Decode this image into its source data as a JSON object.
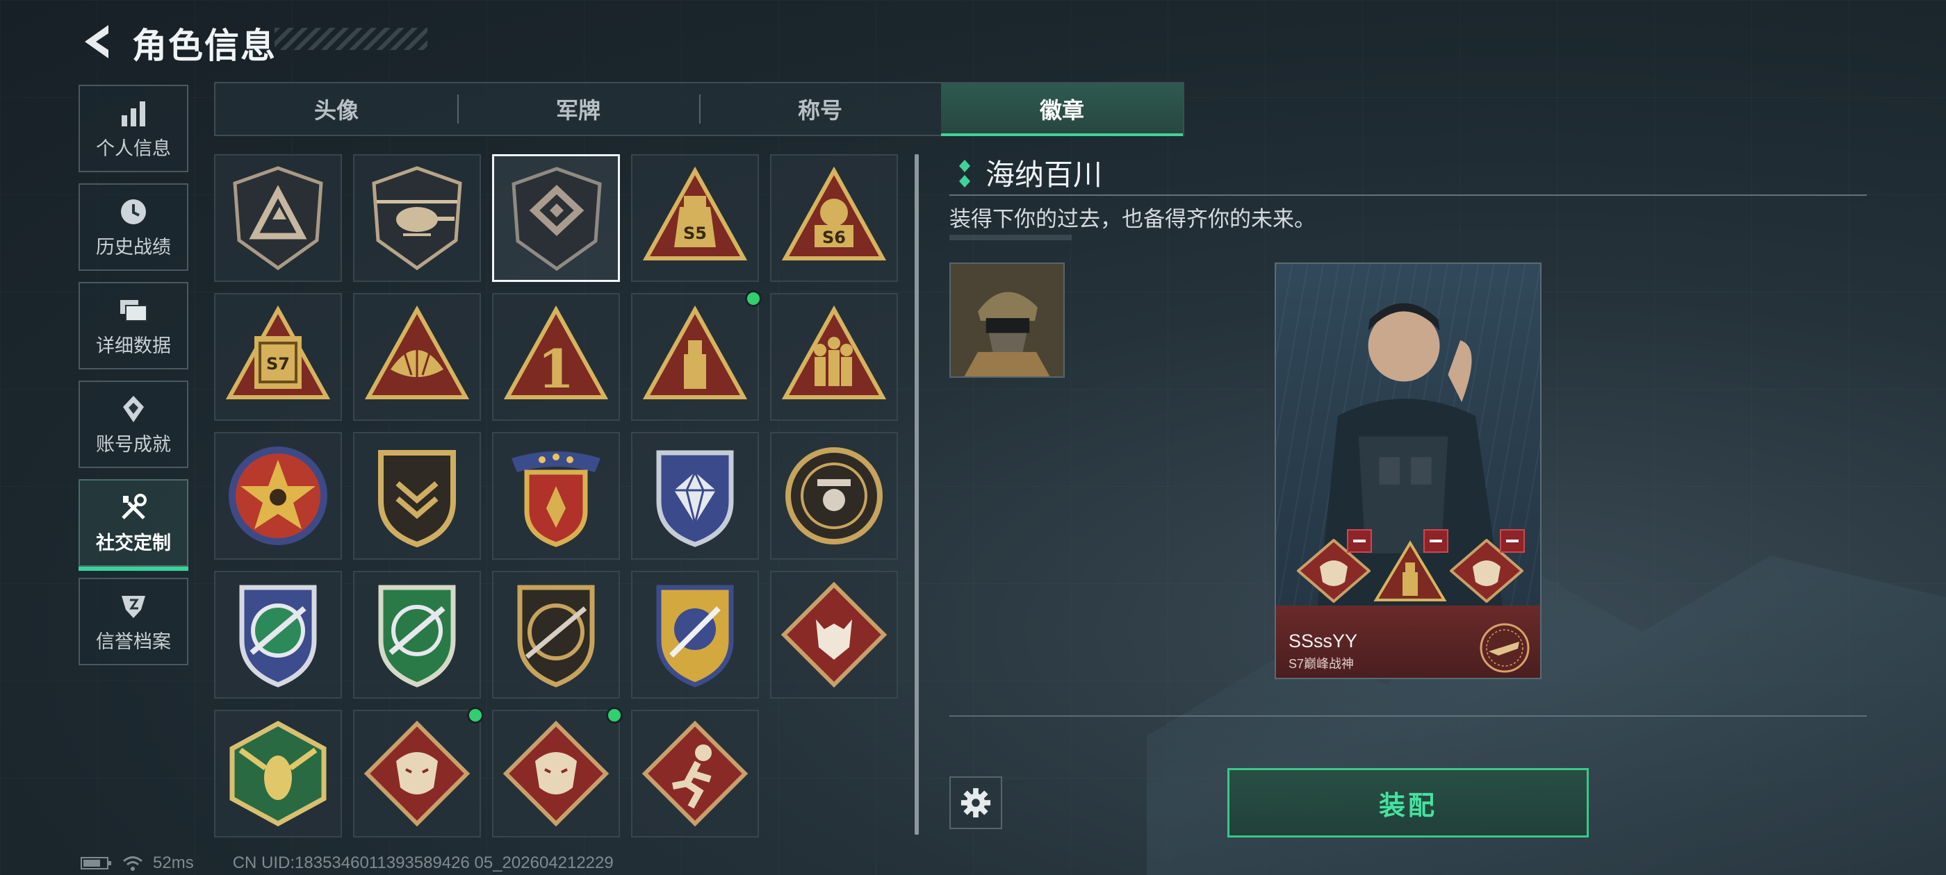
{
  "header": {
    "title": "角色信息"
  },
  "sidebar": {
    "items": [
      {
        "label": "个人信息",
        "icon": "bar-chart-icon"
      },
      {
        "label": "历史战绩",
        "icon": "clock-icon"
      },
      {
        "label": "详细数据",
        "icon": "folder-icon"
      },
      {
        "label": "账号成就",
        "icon": "achievement-icon"
      },
      {
        "label": "社交定制",
        "icon": "wrench-tools-icon",
        "active": true
      },
      {
        "label": "信誉档案",
        "icon": "shield-crest-icon"
      }
    ]
  },
  "tabs": [
    {
      "label": "头像"
    },
    {
      "label": "军牌"
    },
    {
      "label": "称号"
    },
    {
      "label": "徽章",
      "active": true
    }
  ],
  "badges": [
    {
      "name": "badge-triangle-a",
      "icon": "triangle-a-badge-icon"
    },
    {
      "name": "badge-helicopter",
      "icon": "helicopter-badge-icon"
    },
    {
      "name": "badge-diamond-emblem",
      "icon": "diamond-emblem-badge-icon",
      "selected": true
    },
    {
      "name": "badge-s5",
      "icon": "s5-badge-icon",
      "text": "S5"
    },
    {
      "name": "badge-s6",
      "icon": "s6-badge-icon",
      "text": "S6"
    },
    {
      "name": "badge-s7",
      "icon": "s7-badge-icon",
      "text": "S7"
    },
    {
      "name": "badge-shell",
      "icon": "shell-badge-icon"
    },
    {
      "name": "badge-number-one",
      "icon": "number-one-badge-icon",
      "text": "1"
    },
    {
      "name": "badge-usb",
      "icon": "usb-badge-icon",
      "new": true
    },
    {
      "name": "badge-soldiers",
      "icon": "soldiers-badge-icon"
    },
    {
      "name": "badge-star-skull",
      "icon": "star-skull-badge-icon"
    },
    {
      "name": "badge-chevron-shield",
      "icon": "chevron-shield-badge-icon"
    },
    {
      "name": "badge-crest-stars",
      "icon": "crest-stars-badge-icon"
    },
    {
      "name": "badge-gem-shield",
      "icon": "gem-shield-badge-icon"
    },
    {
      "name": "badge-agent",
      "icon": "agent-badge-icon"
    },
    {
      "name": "badge-sniper-blue",
      "icon": "sniper-blue-badge-icon"
    },
    {
      "name": "badge-sniper-green",
      "icon": "sniper-green-badge-icon"
    },
    {
      "name": "badge-rifle-round",
      "icon": "rifle-round-badge-icon"
    },
    {
      "name": "badge-knife-shield",
      "icon": "knife-shield-badge-icon"
    },
    {
      "name": "badge-wolf",
      "icon": "wolf-badge-icon"
    },
    {
      "name": "badge-hornet",
      "icon": "hornet-badge-icon"
    },
    {
      "name": "badge-dragon-1",
      "icon": "dragon-badge-icon",
      "new": true
    },
    {
      "name": "badge-dragon-2",
      "icon": "dragon-badge-icon",
      "new": true
    },
    {
      "name": "badge-runner",
      "icon": "runner-badge-icon"
    }
  ],
  "detail": {
    "title": "海纳百川",
    "description": "装得下你的过去，也备得齐你的未来。",
    "card": {
      "player_name": "SSssYY",
      "rank_text": "S7巅峰战神"
    },
    "equip_label": "装配"
  },
  "status_bar": {
    "ping": "52ms",
    "uid": "CN UID:1835346011393589426 05_202604212229"
  },
  "colors": {
    "accent": "#37d49a",
    "new_dot": "#30d06f",
    "badge_gold": "#c9a552",
    "badge_red": "#8a2a26"
  }
}
